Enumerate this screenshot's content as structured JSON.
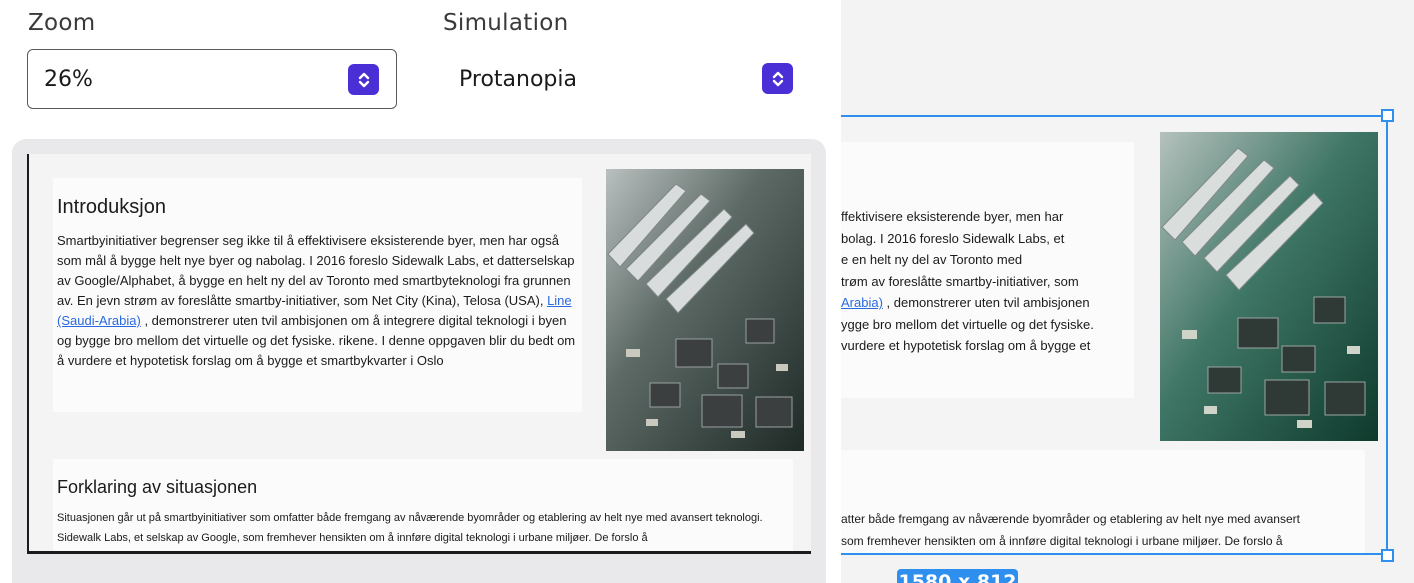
{
  "controls": {
    "zoom_label": "Zoom",
    "zoom_value": "26%",
    "simulation_label": "Simulation",
    "simulation_value": "Protanopia"
  },
  "page": {
    "intro_title": "Introduksjon",
    "intro_text_before_link": "Smartbyinitiativer begrenser seg ikke til å effektivisere eksisterende byer, men har også som mål å bygge helt nye byer og nabolag. I 2016 foreslo Sidewalk Labs, et datterselskap av Google/Alphabet, å bygge en helt ny del av Toronto med smartbyteknologi fra grunnen av. En jevn strøm av foreslåtte smartby-initiativer, som Net City (Kina), Telosa (USA), ",
    "intro_link": "Line (Saudi-Arabia)",
    "intro_text_after_link": " , demonstrerer uten tvil ambisjonen om å integrere digital teknologi i byen og bygge bro mellom det virtuelle og det fysiske. rikene. I denne oppgaven blir du bedt om å vurdere et hypotetisk forslag om å bygge et smartbykvarter i Oslo",
    "situation_title": "Forklaring av situasjonen",
    "situation_text": "Situasjonen går ut på smartbyinitiativer som omfatter både fremgang av nåværende byområder og etablering av helt nye med avansert teknologi. Sidewalk Labs, et selskap av Google, som fremhever hensikten om å innføre digital teknologi i urbane miljøer. De forslo å"
  },
  "canvas": {
    "intro_lines": [
      "ffektivisere eksisterende byer, men har",
      "bolag. I 2016 foreslo Sidewalk Labs, et",
      "e en helt ny del av Toronto med",
      "trøm av foreslåtte smartby-initiativer, som"
    ],
    "intro_link_fragment": "Arabia)",
    "intro_after_link": " , demonstrerer uten tvil ambisjonen",
    "intro_lines_end": [
      "ygge bro mellom det virtuelle og det fysiske.",
      " vurdere et hypotetisk forslag om å bygge et"
    ],
    "situation_lines": [
      "atter både fremgang av nåværende byområder og etablering av helt nye med avansert",
      "som fremhever hensikten om å innføre digital teknologi i urbane miljøer. De forslo å"
    ],
    "size_badge": "1580 x 812"
  },
  "icons": {
    "zoom_spinner": "up-down-chevron-icon",
    "simulation_spinner": "up-down-chevron-icon",
    "photo": "circuit-board-heatsink-photo"
  },
  "colors": {
    "accent": "#4a2fd6",
    "selection": "#2f8fef",
    "link": "#2a6ae0"
  }
}
